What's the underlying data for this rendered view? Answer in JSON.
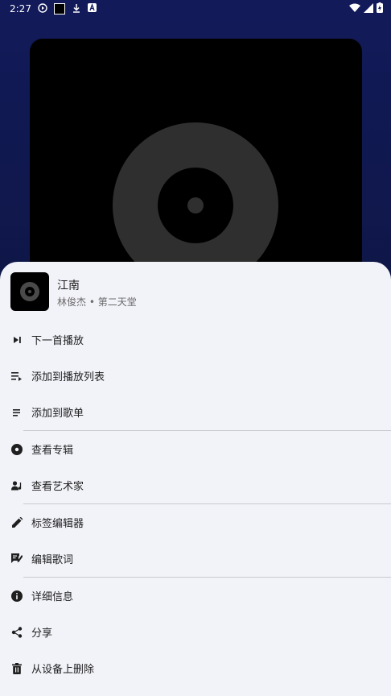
{
  "status_bar": {
    "time": "2:27",
    "left_icons": [
      "play-circle-icon",
      "black-square-icon",
      "download-icon",
      "a-badge-icon"
    ],
    "right_icons": [
      "wifi-icon",
      "signal-icon",
      "battery-charging-icon"
    ]
  },
  "song": {
    "title": "江南",
    "subtitle": "林俊杰 • 第二天堂"
  },
  "menu": {
    "play_next": "下一首播放",
    "add_to_queue": "添加到播放列表",
    "add_to_playlist": "添加到歌单",
    "view_album": "查看专辑",
    "view_artist": "查看艺术家",
    "tag_editor": "标签编辑器",
    "edit_lyrics": "编辑歌词",
    "details": "详细信息",
    "share": "分享",
    "delete_from_device": "从设备上删除"
  },
  "colors": {
    "background_top": "#121a5a",
    "sheet": "#f2f3f9",
    "disc": "#2f2f2f",
    "icon": "#1f1f1f"
  }
}
